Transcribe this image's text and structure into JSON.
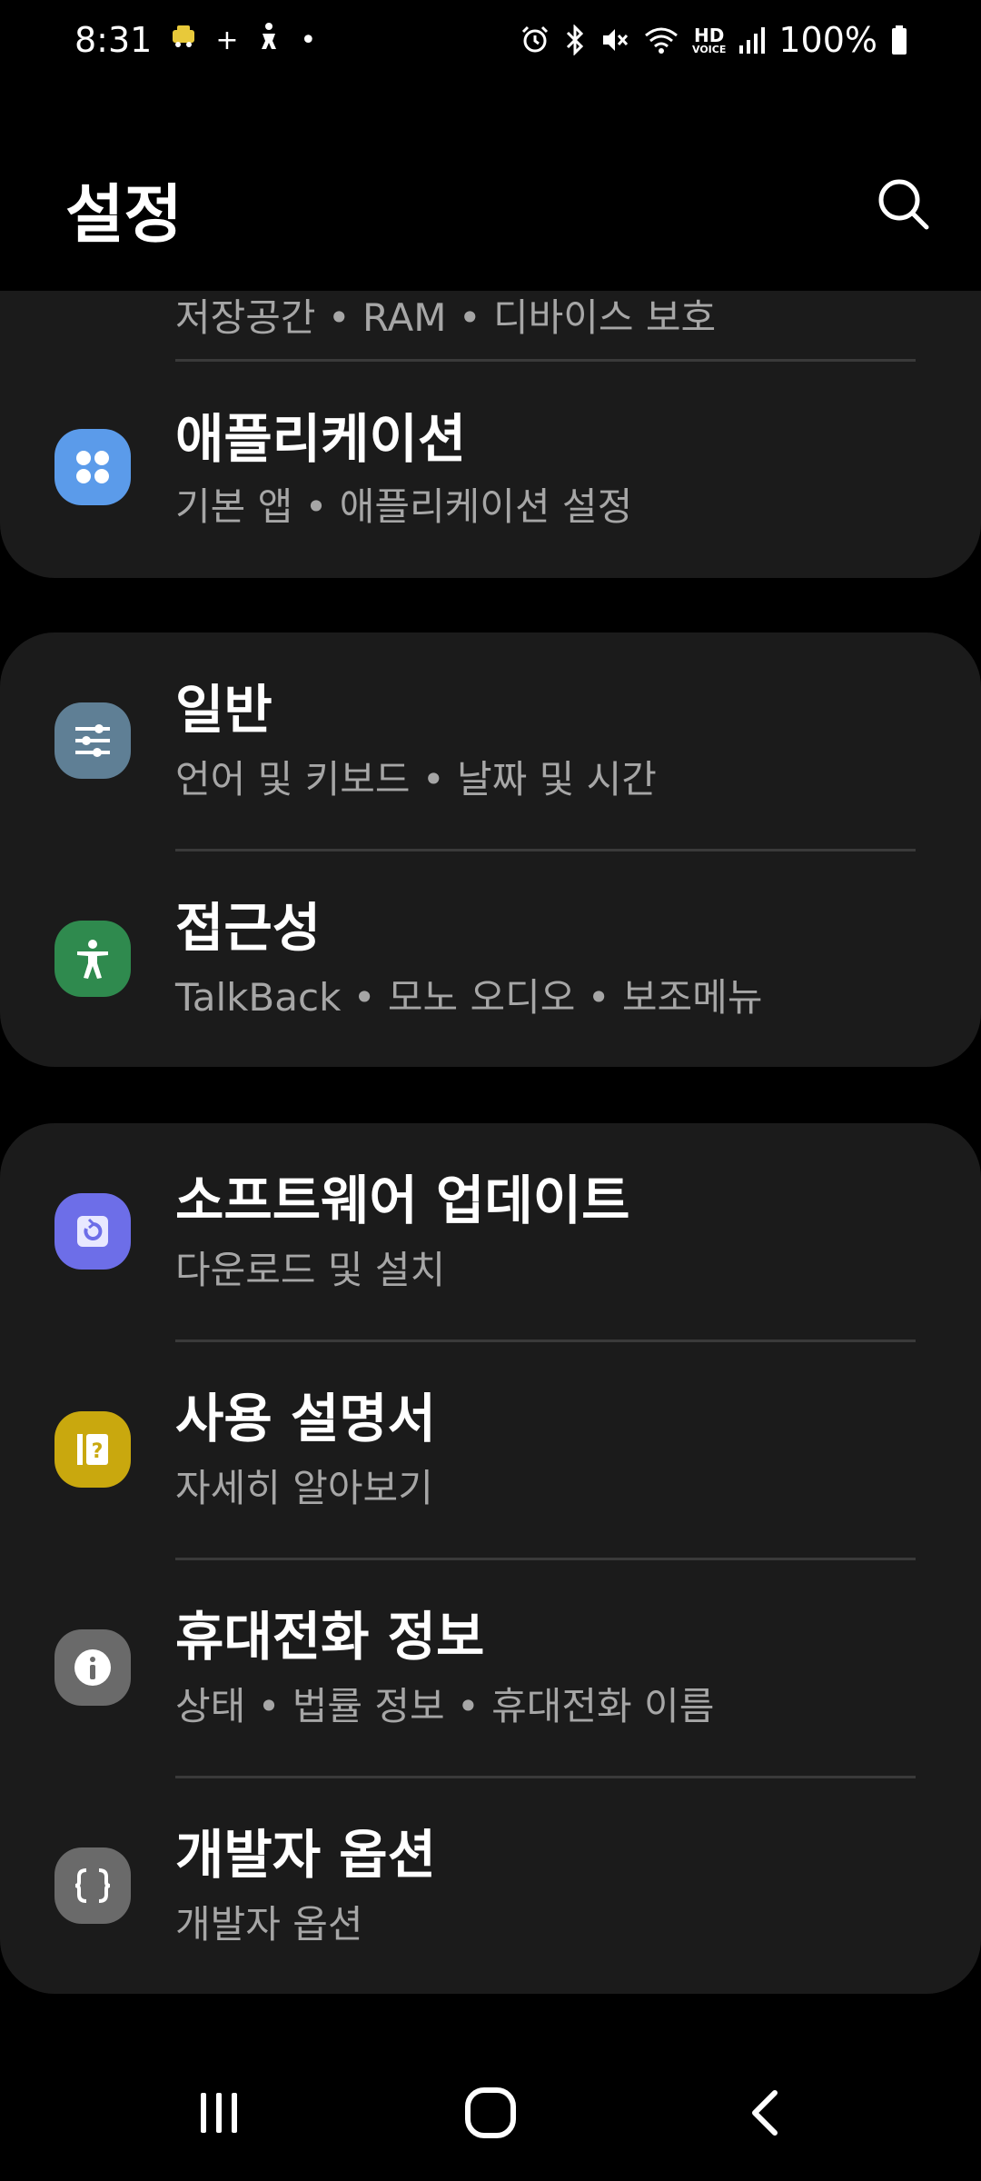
{
  "status_bar": {
    "time": "8:31",
    "left_icons": [
      "taxi-icon",
      "plus-icon",
      "accessibility-person-icon",
      "dot-icon"
    ],
    "plus": "+",
    "dot": "•",
    "right_icons": [
      "alarm-icon",
      "bluetooth-icon",
      "mute-icon",
      "wifi-icon",
      "hd-voice-icon",
      "signal-icon",
      "battery-icon"
    ],
    "hd": "HD",
    "voice": "VOICE",
    "battery_percent": "100%",
    "battery_level": 1.0
  },
  "header": {
    "title": "설정",
    "search_icon": "search-icon"
  },
  "cards": {
    "card1": {
      "partial_subtitle": "저장공간 • RAM • 디바이스 보호",
      "items": [
        {
          "title": "애플리케이션",
          "subtitle": "기본 앱 • 애플리케이션 설정",
          "icon": "apps-icon",
          "icon_color": "#5b9bea"
        }
      ]
    },
    "card2": {
      "items": [
        {
          "title": "일반",
          "subtitle": "언어 및 키보드 • 날짜 및 시간",
          "icon": "sliders-icon",
          "icon_color": "#5f7f95"
        },
        {
          "title": "접근성",
          "subtitle": "TalkBack • 모노 오디오 • 보조메뉴",
          "icon": "accessibility-icon",
          "icon_color": "#2f8a4e"
        }
      ]
    },
    "card3": {
      "items": [
        {
          "title": "소프트웨어 업데이트",
          "subtitle": "다운로드 및 설치",
          "icon": "software-update-icon",
          "icon_color": "#6d6ee8"
        },
        {
          "title": "사용 설명서",
          "subtitle": "자세히 알아보기",
          "icon": "user-manual-icon",
          "icon_color": "#c9a80e"
        },
        {
          "title": "휴대전화 정보",
          "subtitle": "상태 • 법률 정보 • 휴대전화 이름",
          "icon": "info-icon",
          "icon_color": "#6a6a6a"
        },
        {
          "title": "개발자 옵션",
          "subtitle": "개발자 옵션",
          "icon": "developer-options-icon",
          "icon_color": "#6a6a6a"
        }
      ]
    }
  },
  "nav_bar": {
    "recents_icon": "recents-icon",
    "home_icon": "home-icon",
    "back_icon": "back-icon"
  }
}
